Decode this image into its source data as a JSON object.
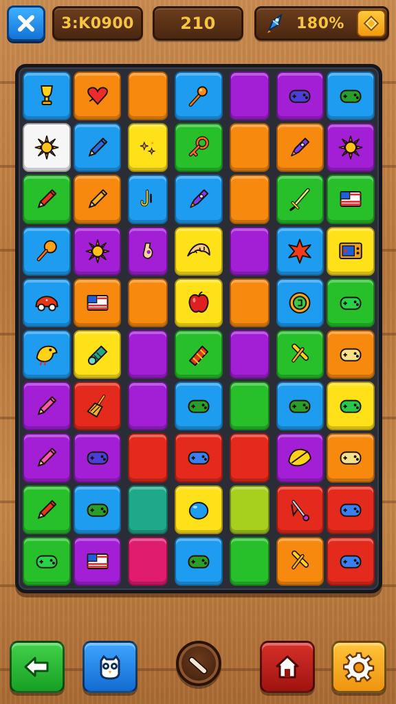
{
  "header": {
    "level_code": "3:K0900",
    "score": "210",
    "power_percent": "180%"
  },
  "colors": {
    "blue": "#1e9cf0",
    "orange": "#f7890f",
    "purple": "#a21fd6",
    "green": "#27c02a",
    "yellow": "#ffe11a",
    "red": "#e32a1c",
    "white": "#f6f6f6",
    "teal": "#1fa88a",
    "lime": "#a6cf1e",
    "magenta": "#e01c6e"
  },
  "board": {
    "rows": [
      [
        {
          "color": "blue",
          "icon": "trophy-icon"
        },
        {
          "color": "orange",
          "icon": "heart-bubble-icon"
        },
        {
          "color": "orange",
          "icon": "none",
          "narrow": true
        },
        {
          "color": "blue",
          "icon": "torch-icon"
        },
        {
          "color": "purple",
          "icon": "none",
          "narrow": true
        },
        {
          "color": "purple",
          "icon": "gamepad-icon"
        },
        {
          "color": "blue",
          "icon": "gamepad-icon"
        }
      ],
      [
        {
          "color": "white",
          "icon": "sun-icon"
        },
        {
          "color": "blue",
          "icon": "pencil-icon"
        },
        {
          "color": "yellow",
          "icon": "sparkle-icon",
          "narrow": true
        },
        {
          "color": "green",
          "icon": "key-icon"
        },
        {
          "color": "orange",
          "icon": "none",
          "narrow": true
        },
        {
          "color": "orange",
          "icon": "rocket-icon"
        },
        {
          "color": "purple",
          "icon": "sun-icon"
        }
      ],
      [
        {
          "color": "green",
          "icon": "pencil-icon"
        },
        {
          "color": "orange",
          "icon": "pencil-icon"
        },
        {
          "color": "blue",
          "icon": "hook-icon",
          "narrow": true
        },
        {
          "color": "blue",
          "icon": "rocket-icon"
        },
        {
          "color": "orange",
          "icon": "none",
          "narrow": true
        },
        {
          "color": "green",
          "icon": "sword-icon"
        },
        {
          "color": "green",
          "icon": "flag-icon"
        }
      ],
      [
        {
          "color": "blue",
          "icon": "lollipop-icon"
        },
        {
          "color": "purple",
          "icon": "sun-icon"
        },
        {
          "color": "purple",
          "icon": "potion-icon",
          "narrow": true
        },
        {
          "color": "yellow",
          "icon": "croissant-icon"
        },
        {
          "color": "purple",
          "icon": "none",
          "narrow": true
        },
        {
          "color": "blue",
          "icon": "star-burst-icon"
        },
        {
          "color": "yellow",
          "icon": "tv-icon"
        }
      ],
      [
        {
          "color": "blue",
          "icon": "car-icon"
        },
        {
          "color": "orange",
          "icon": "flag-icon"
        },
        {
          "color": "orange",
          "icon": "none",
          "narrow": true
        },
        {
          "color": "yellow",
          "icon": "apple-icon"
        },
        {
          "color": "orange",
          "icon": "none",
          "narrow": true
        },
        {
          "color": "blue",
          "icon": "coin-icon"
        },
        {
          "color": "green",
          "icon": "gamepad-icon"
        }
      ],
      [
        {
          "color": "blue",
          "icon": "bird-icon"
        },
        {
          "color": "yellow",
          "icon": "scroll-icon"
        },
        {
          "color": "purple",
          "icon": "none",
          "narrow": true
        },
        {
          "color": "green",
          "icon": "candy-bar-icon"
        },
        {
          "color": "purple",
          "icon": "none",
          "narrow": true
        },
        {
          "color": "green",
          "icon": "hammer-icon"
        },
        {
          "color": "orange",
          "icon": "gamepad-icon"
        }
      ],
      [
        {
          "color": "purple",
          "icon": "pencil-icon"
        },
        {
          "color": "red",
          "icon": "broom-icon"
        },
        {
          "color": "purple",
          "icon": "none",
          "narrow": true
        },
        {
          "color": "blue",
          "icon": "gamepad-icon"
        },
        {
          "color": "green",
          "icon": "none",
          "narrow": true
        },
        {
          "color": "blue",
          "icon": "gamepad-icon"
        },
        {
          "color": "yellow",
          "icon": "gamepad-icon"
        }
      ],
      [
        {
          "color": "purple",
          "icon": "pencil-icon"
        },
        {
          "color": "purple",
          "icon": "gamepad-icon"
        },
        {
          "color": "red",
          "icon": "none",
          "narrow": true
        },
        {
          "color": "red",
          "icon": "gamepad-icon"
        },
        {
          "color": "red",
          "icon": "none",
          "narrow": true
        },
        {
          "color": "purple",
          "icon": "taco-icon"
        },
        {
          "color": "orange",
          "icon": "gamepad-icon"
        }
      ],
      [
        {
          "color": "green",
          "icon": "pencil-icon"
        },
        {
          "color": "blue",
          "icon": "gamepad-icon"
        },
        {
          "color": "teal",
          "icon": "none",
          "narrow": true
        },
        {
          "color": "yellow",
          "icon": "blue-ball-icon"
        },
        {
          "color": "lime",
          "icon": "none",
          "narrow": true
        },
        {
          "color": "red",
          "icon": "wand-icon"
        },
        {
          "color": "red",
          "icon": "gamepad-icon"
        }
      ],
      [
        {
          "color": "green",
          "icon": "gamepad-icon"
        },
        {
          "color": "purple",
          "icon": "flag-icon"
        },
        {
          "color": "magenta",
          "icon": "none",
          "narrow": true
        },
        {
          "color": "blue",
          "icon": "gamepad-icon"
        },
        {
          "color": "green",
          "icon": "none",
          "narrow": true
        },
        {
          "color": "orange",
          "icon": "hammer-icon"
        },
        {
          "color": "red",
          "icon": "gamepad-icon"
        }
      ]
    ]
  },
  "footer": {
    "buttons": [
      {
        "name": "back-button",
        "icon": "arrow-left-icon"
      },
      {
        "name": "hint-button",
        "icon": "owl-icon"
      },
      {
        "name": "shuffle-button",
        "icon": "stick-icon"
      },
      {
        "name": "home-button",
        "icon": "house-icon"
      },
      {
        "name": "settings-button",
        "icon": "gear-icon"
      }
    ]
  }
}
